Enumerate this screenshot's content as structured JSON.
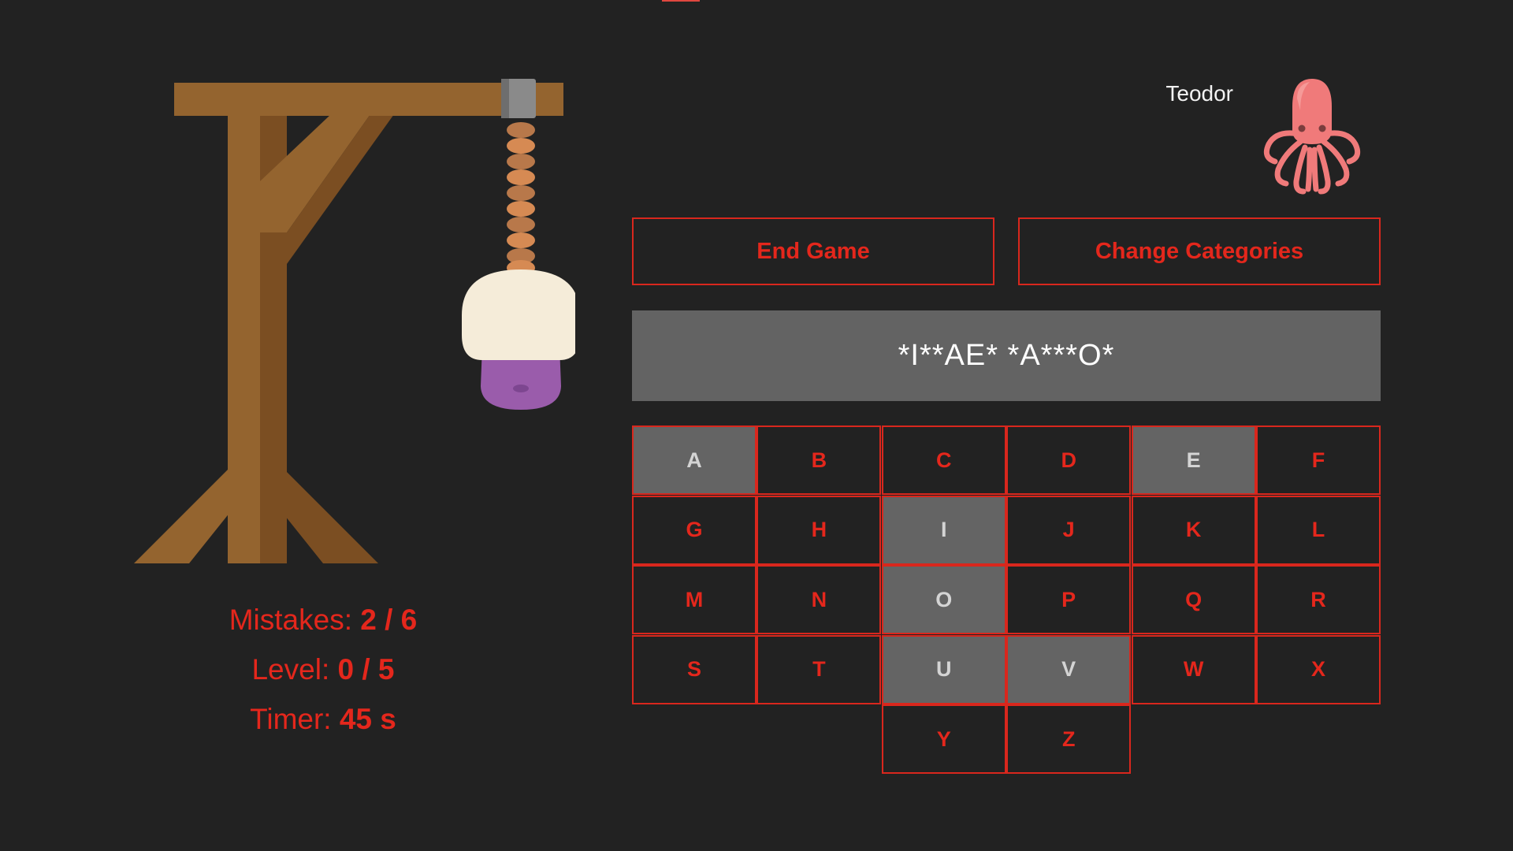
{
  "player": {
    "name": "Teodor",
    "avatar_icon": "octopus-icon"
  },
  "buttons": {
    "end_game": "End Game",
    "change_categories": "Change Categories"
  },
  "word": {
    "masked": "*I**AE* *A***O*"
  },
  "stats": {
    "mistakes_label": "Mistakes:",
    "mistakes_value": "2 / 6",
    "level_label": "Level:",
    "level_value": "0 / 5",
    "timer_label": "Timer:",
    "timer_value": "45 s"
  },
  "keyboard": {
    "keys": [
      {
        "letter": "A",
        "used": true
      },
      {
        "letter": "B",
        "used": false
      },
      {
        "letter": "C",
        "used": false
      },
      {
        "letter": "D",
        "used": false
      },
      {
        "letter": "E",
        "used": true
      },
      {
        "letter": "F",
        "used": false
      },
      {
        "letter": "G",
        "used": false
      },
      {
        "letter": "H",
        "used": false
      },
      {
        "letter": "I",
        "used": true
      },
      {
        "letter": "J",
        "used": false
      },
      {
        "letter": "K",
        "used": false
      },
      {
        "letter": "L",
        "used": false
      },
      {
        "letter": "M",
        "used": false
      },
      {
        "letter": "N",
        "used": false
      },
      {
        "letter": "O",
        "used": true
      },
      {
        "letter": "P",
        "used": false
      },
      {
        "letter": "Q",
        "used": false
      },
      {
        "letter": "R",
        "used": false
      },
      {
        "letter": "S",
        "used": false
      },
      {
        "letter": "T",
        "used": false
      },
      {
        "letter": "U",
        "used": true
      },
      {
        "letter": "V",
        "used": true
      },
      {
        "letter": "W",
        "used": false
      },
      {
        "letter": "X",
        "used": false
      },
      {
        "letter": "Y",
        "used": false
      },
      {
        "letter": "Z",
        "used": false
      }
    ]
  },
  "colors": {
    "background": "#222222",
    "accent": "#e4271c",
    "used_key": "#646464",
    "word_box": "#636363"
  }
}
